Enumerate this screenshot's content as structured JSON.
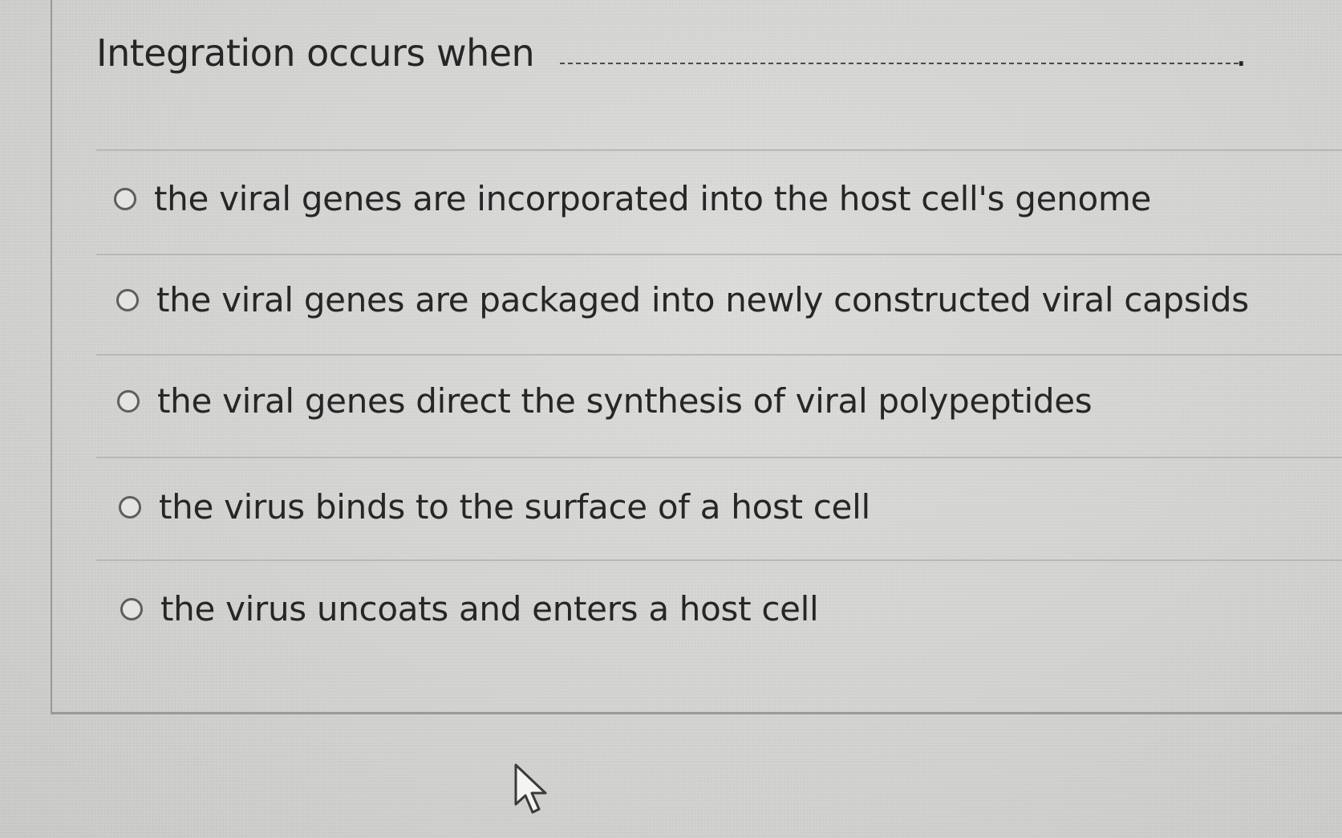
{
  "question": {
    "stem": "Integration occurs when",
    "blank_end": "."
  },
  "choices": [
    {
      "label": "the viral genes are incorporated into the host cell's genome",
      "selected": false
    },
    {
      "label": "the viral genes are packaged into newly constructed viral capsids",
      "selected": false
    },
    {
      "label": "the viral genes direct the synthesis of viral polypeptides",
      "selected": false
    },
    {
      "label": "the virus binds to the surface of a host cell",
      "selected": false
    },
    {
      "label": "the virus uncoats and enters a host cell",
      "selected": false
    }
  ],
  "icons": {
    "cursor": "mouse-pointer-icon",
    "radio": "radio-button-icon"
  },
  "colors": {
    "text": "#262626",
    "background": "#d2d2d0",
    "border": "#9a9a98"
  }
}
